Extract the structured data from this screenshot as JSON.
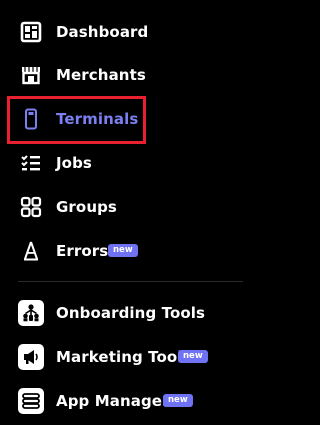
{
  "nav": {
    "items": [
      {
        "label": "Dashboard",
        "icon": "dashboard-icon"
      },
      {
        "label": "Merchants",
        "icon": "storefront-icon"
      },
      {
        "label": "Terminals",
        "icon": "terminal-icon",
        "active": true
      },
      {
        "label": "Jobs",
        "icon": "checklist-icon"
      },
      {
        "label": "Groups",
        "icon": "grid-icon"
      },
      {
        "label": "Errors",
        "icon": "error-icon",
        "badge": "new"
      }
    ],
    "tools": [
      {
        "label": "Onboarding Tools",
        "icon": "onboarding-icon"
      },
      {
        "label": "Marketing Tools",
        "icon": "megaphone-icon",
        "badge": "new"
      },
      {
        "label": "App Manager",
        "icon": "app-manager-icon",
        "badge": "new"
      }
    ]
  },
  "colors": {
    "background": "#000000",
    "text": "#ffffff",
    "active_text": "#7b7ff0",
    "badge": "#6f72f2",
    "highlight_border": "#e8202f"
  }
}
